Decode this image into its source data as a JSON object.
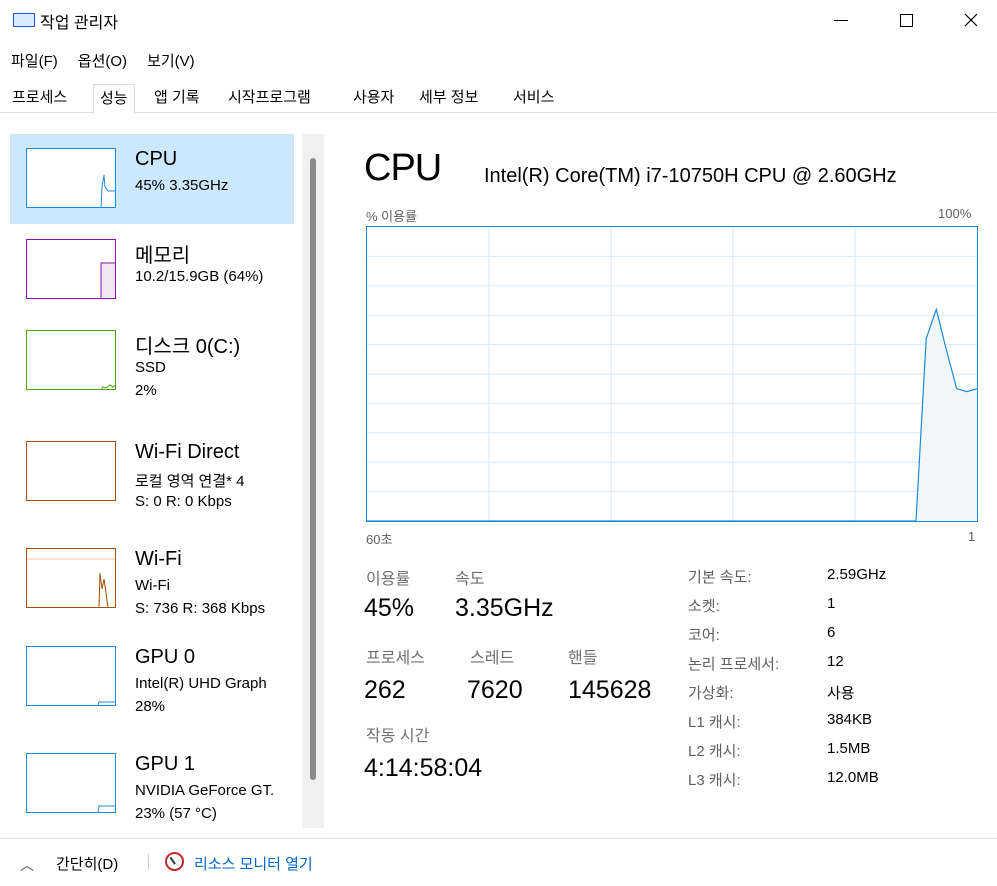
{
  "window": {
    "title": "작업 관리자"
  },
  "menu": {
    "items": [
      "파일(F)",
      "옵션(O)",
      "보기(V)"
    ]
  },
  "tabs": [
    "프로세스",
    "성능",
    "앱 기록",
    "시작프로그램",
    "사용자",
    "세부 정보",
    "서비스"
  ],
  "active_tab": "성능",
  "sidebar": {
    "items": [
      {
        "name": "CPU",
        "sub1": "45% 3.35GHz",
        "sub2": "",
        "color": "#1e8ad6"
      },
      {
        "name": "메모리",
        "sub1": "10.2/15.9GB (64%)",
        "sub2": "",
        "color": "#8b12ae"
      },
      {
        "name": "디스크 0(C:)",
        "sub1": "SSD",
        "sub2": "2%",
        "color": "#4da60c"
      },
      {
        "name": "Wi-Fi Direct",
        "sub1": "로컬 영역 연결* 4",
        "sub2": "S: 0 R: 0 Kbps",
        "color": "#a74f01"
      },
      {
        "name": "Wi-Fi",
        "sub1": "Wi-Fi",
        "sub2": "S: 736 R: 368 Kbps",
        "color": "#a74f01"
      },
      {
        "name": "GPU 0",
        "sub1": "Intel(R) UHD Graph",
        "sub2": "28%",
        "color": "#1e8ad6"
      },
      {
        "name": "GPU 1",
        "sub1": "NVIDIA GeForce GT.",
        "sub2": "23% (57 °C)",
        "color": "#1e8ad6"
      }
    ]
  },
  "main": {
    "title": "CPU",
    "model": "Intel(R) Core(TM) i7-10750H CPU @ 2.60GHz",
    "graph_top_left": "% 이용률",
    "graph_top_right": "100%",
    "graph_bottom_left": "60초",
    "graph_bottom_right": "1",
    "graph_color": "#1e8ad6",
    "graph_fill": "#f1f6fa",
    "graph_grid": "#d9eaf7"
  },
  "chart_data": {
    "type": "area",
    "ylabel": "% 이용률",
    "ylim": [
      0,
      100
    ],
    "xlim": [
      60,
      0
    ],
    "x": [
      60,
      55,
      50,
      45,
      40,
      35,
      30,
      28,
      27,
      26,
      25,
      24,
      23,
      22,
      21,
      20,
      19,
      18,
      17,
      16,
      15,
      14,
      13,
      12,
      11,
      10,
      9,
      8,
      7,
      6,
      5,
      4,
      3,
      2,
      1,
      0
    ],
    "values": [
      0,
      0,
      0,
      0,
      0,
      0,
      0,
      0,
      0,
      0,
      0,
      0,
      0,
      0,
      0,
      0,
      0,
      0,
      0,
      0,
      0,
      0,
      0,
      0,
      0,
      0,
      0,
      0,
      0,
      0,
      62,
      72,
      58,
      45,
      44,
      45
    ]
  },
  "stats": {
    "utilization_label": "이용률",
    "utilization_value": "45%",
    "speed_label": "속도",
    "speed_value": "3.35GHz",
    "processes_label": "프로세스",
    "processes_value": "262",
    "threads_label": "스레드",
    "threads_value": "7620",
    "handles_label": "핸들",
    "handles_value": "145628",
    "uptime_label": "작동 시간",
    "uptime_value": "4:14:58:04"
  },
  "info": [
    {
      "label": "기본 속도:",
      "value": "2.59GHz"
    },
    {
      "label": "소켓:",
      "value": "1"
    },
    {
      "label": "코어:",
      "value": "6"
    },
    {
      "label": "논리 프로세서:",
      "value": "12"
    },
    {
      "label": "가상화:",
      "value": "사용"
    },
    {
      "label": "L1 캐시:",
      "value": "384KB"
    },
    {
      "label": "L2 캐시:",
      "value": "1.5MB"
    },
    {
      "label": "L3 캐시:",
      "value": "12.0MB"
    }
  ],
  "bottom": {
    "collapse_label": "간단히(D)",
    "monitor_label": "리소스 모니터 열기"
  }
}
